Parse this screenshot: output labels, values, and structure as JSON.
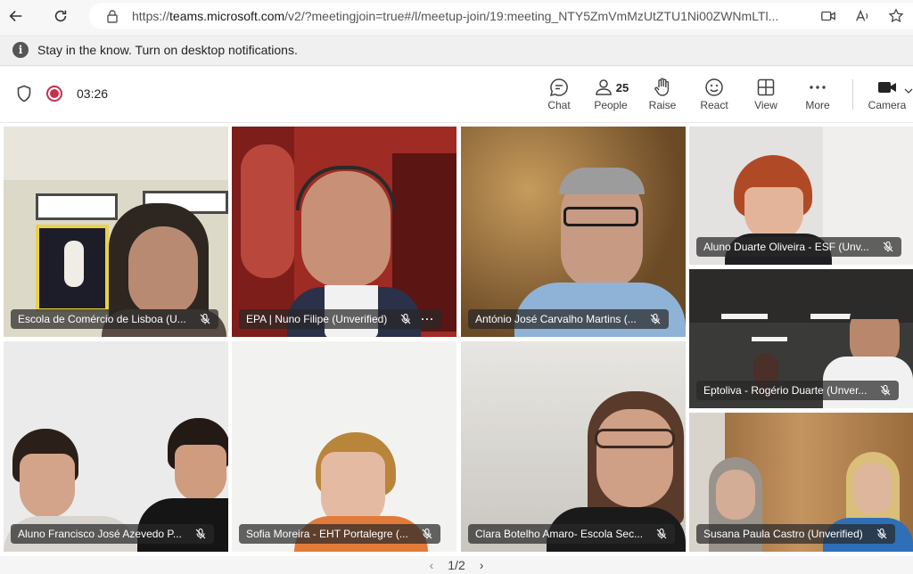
{
  "browser": {
    "url_prefix": "https://",
    "url_host": "teams.microsoft.com",
    "url_rest": "/v2/?meetingjoin=true#/l/meetup-join/19:meeting_NTY5ZmVmMzUtZTU1Ni00ZWNmLTl..."
  },
  "notification": {
    "text": "Stay in the know. Turn on desktop notifications."
  },
  "meeting": {
    "timer": "03:26"
  },
  "toolbar": {
    "chat": "Chat",
    "people": "People",
    "people_count": "25",
    "raise": "Raise",
    "react": "React",
    "view": "View",
    "more": "More",
    "camera": "Camera"
  },
  "participants": [
    {
      "name": "Escola de Comércio de Lisboa (U...",
      "muted": true
    },
    {
      "name": "EPA | Nuno Filipe (Unverified)",
      "muted": true
    },
    {
      "name": "António José Carvalho Martins (...",
      "muted": true
    },
    {
      "name": "Aluno Duarte Oliveira - ESF (Unv...",
      "muted": true
    },
    {
      "name": "Eptoliva - Rogério Duarte (Unver...",
      "muted": true
    },
    {
      "name": "Aluno Francisco José Azevedo P...",
      "muted": true
    },
    {
      "name": "Sofia Moreira - EHT Portalegre (...",
      "muted": true
    },
    {
      "name": "Clara Botelho Amaro- Escola Sec...",
      "muted": true
    },
    {
      "name": "Susana Paula Castro (Unverified)",
      "muted": true
    }
  ],
  "pager": {
    "label": "1/2"
  },
  "colors": {
    "recording": "#c4314b",
    "brand": "#6264a7"
  }
}
